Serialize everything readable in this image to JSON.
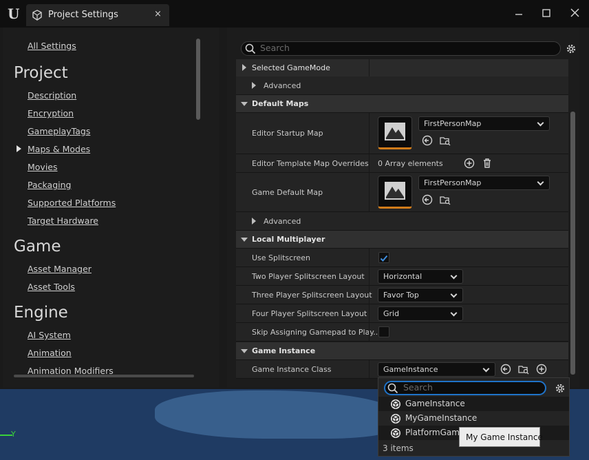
{
  "window": {
    "tab_title": "Project Settings",
    "tab_close": "×"
  },
  "nav": {
    "all_settings": "All Settings",
    "sections": [
      {
        "heading": "Project",
        "items": [
          "Description",
          "Encryption",
          "GameplayTags",
          "Maps & Modes",
          "Movies",
          "Packaging",
          "Supported Platforms",
          "Target Hardware"
        ]
      },
      {
        "heading": "Game",
        "items": [
          "Asset Manager",
          "Asset Tools"
        ]
      },
      {
        "heading": "Engine",
        "items": [
          "AI System",
          "Animation",
          "Animation Modifiers"
        ]
      }
    ],
    "selected_item": "Maps & Modes"
  },
  "search": {
    "placeholder": "Search"
  },
  "properties": {
    "selected_gamemode": "Selected GameMode",
    "advanced": "Advanced",
    "default_maps": "Default Maps",
    "editor_startup_map": {
      "label": "Editor Startup Map",
      "value": "FirstPersonMap"
    },
    "editor_template_overrides": {
      "label": "Editor Template Map Overrides",
      "value": "0 Array elements"
    },
    "game_default_map": {
      "label": "Game Default Map",
      "value": "FirstPersonMap"
    },
    "local_multiplayer": "Local Multiplayer",
    "use_splitscreen": {
      "label": "Use Splitscreen",
      "checked": true
    },
    "two_player": {
      "label": "Two Player Splitscreen Layout",
      "value": "Horizontal"
    },
    "three_player": {
      "label": "Three Player Splitscreen Layout",
      "value": "Favor Top"
    },
    "four_player": {
      "label": "Four Player Splitscreen Layout",
      "value": "Grid"
    },
    "skip_gamepad": {
      "label": "Skip Assigning Gamepad to Play...",
      "checked": false
    },
    "game_instance": "Game Instance",
    "game_instance_class": {
      "label": "Game Instance Class",
      "value": "GameInstance"
    }
  },
  "dropdown": {
    "placeholder": "Search",
    "items": [
      "GameInstance",
      "MyGameInstance",
      "PlatformGam"
    ],
    "count": "3 items"
  },
  "tooltip": "My Game Instance",
  "viewport": {
    "axis_label": "Y"
  },
  "colors": {
    "accent_blue": "#1f73c9",
    "thumb_orange": "#d07b1a",
    "axis_green": "#3ad13a"
  }
}
